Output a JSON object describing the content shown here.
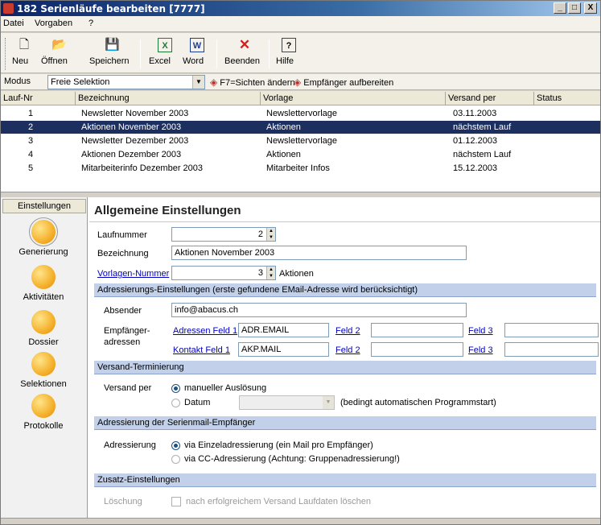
{
  "window": {
    "title": "182 Serienläufe bearbeiten [7777]",
    "min": "_",
    "max": "□",
    "close": "X"
  },
  "menu": [
    "Datei",
    "Vorgaben",
    "?"
  ],
  "toolbar": {
    "new": "Neu",
    "open": "Öffnen",
    "save": "Speichern",
    "excel": "Excel",
    "word": "Word",
    "quit": "Beenden",
    "help": "Hilfe"
  },
  "modus": {
    "label": "Modus",
    "value": "Freie Selektion",
    "action1": "F7=Sichten ändern",
    "action2": "Empfänger aufbereiten"
  },
  "table": {
    "headers": [
      "Lauf-Nr",
      "Bezeichnung",
      "Vorlage",
      "Versand per",
      "Status"
    ],
    "rows": [
      [
        "1",
        "Newsletter November 2003",
        "Newslettervorlage",
        "03.11.2003",
        ""
      ],
      [
        "2",
        "Aktionen November 2003",
        "Aktionen",
        "nächstem Lauf",
        ""
      ],
      [
        "3",
        "Newsletter Dezember 2003",
        "Newslettervorlage",
        "01.12.2003",
        ""
      ],
      [
        "4",
        "Aktionen Dezember 2003",
        "Aktionen",
        "nächstem Lauf",
        ""
      ],
      [
        "5",
        "Mitarbeiterinfo Dezember 2003",
        "Mitarbeiter Infos",
        "15.12.2003",
        ""
      ]
    ],
    "selected_row": 2
  },
  "nav": {
    "header": "Einstellungen",
    "items": [
      "Generierung",
      "Aktivitäten",
      "Dossier",
      "Selektionen",
      "Protokolle"
    ]
  },
  "settings": {
    "title": "Allgemeine Einstellungen",
    "laufnummer_label": "Laufnummer",
    "laufnummer": "2",
    "bezeichnung_label": "Bezeichnung",
    "bezeichnung": "Aktionen November 2003",
    "vorlage_label": "Vorlagen-Nummer",
    "vorlage": "3",
    "vorlage_name": "Aktionen",
    "sec_address": "Adressierungs-Einstellungen (erste gefundene EMail-Adresse wird berücksichtigt)",
    "absender_label": "Absender",
    "absender": "info@abacus.ch",
    "empf_label1": "Empfänger-",
    "empf_label2": "adressen",
    "adr_feld1": "Adressen Feld 1",
    "adr_feld1_val": "ADR.EMAIL",
    "kon_feld1": "Kontakt Feld 1",
    "kon_feld1_val": "AKP.MAIL",
    "feld2": "Feld 2",
    "feld3": "Feld 3",
    "sec_term": "Versand-Terminierung",
    "versand_label": "Versand per",
    "opt_manual": "manueller Auslösung",
    "opt_date": "Datum",
    "date_note": "(bedingt automatischen Programmstart)",
    "sec_serien": "Adressierung der Serienmail-Empfänger",
    "adr_label": "Adressierung",
    "opt_einzel": "via Einzeladressierung (ein Mail pro Empfänger)",
    "opt_cc": "via CC-Adressierung (Achtung: Gruppenadressierung!)",
    "sec_zusatz": "Zusatz-Einstellungen",
    "loesch_label": "Löschung",
    "loesch_text": "nach erfolgreichem Versand Laufdaten löschen"
  },
  "colors": {
    "title_bar": "#0a246a",
    "selection": "#1c2f5f",
    "section": "#c2d0ea",
    "link": "#0000c0"
  }
}
